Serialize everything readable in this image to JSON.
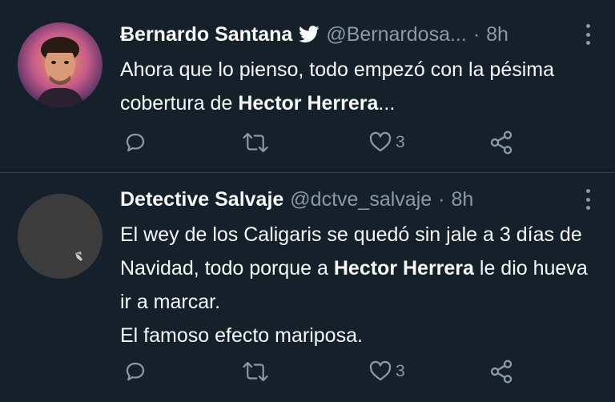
{
  "tweets": [
    {
      "author_name": "Ƀernardo Santana",
      "handle": "@Bernardosa...",
      "separator": "·",
      "time": "8h",
      "verified": true,
      "body_segments": [
        {
          "text": "Ahora que lo pienso, todo empezó con la pésima cobertura de ",
          "bold": false
        },
        {
          "text": "Hector Herrera",
          "bold": true
        },
        {
          "text": "...",
          "bold": false
        }
      ],
      "like_count": "3"
    },
    {
      "author_name": "Detective Salvaje",
      "handle": "@dctve_salvaje",
      "separator": "·",
      "time": "8h",
      "verified": false,
      "body_segments": [
        {
          "text": "El wey de los Caligaris se quedó sin jale a 3 días de Navidad, todo porque a ",
          "bold": false
        },
        {
          "text": "Hector Herrera",
          "bold": true
        },
        {
          "text": " le dio hueva ir a marcar.",
          "bold": false
        },
        {
          "text": "El famoso efecto mariposa.",
          "bold": false
        }
      ],
      "like_count": "3"
    }
  ],
  "icons": {
    "reply": "reply-icon",
    "retweet": "retweet-icon",
    "like": "heart-icon",
    "share": "share-icon",
    "more": "more-vertical-icon",
    "verified": "twitter-bird-icon"
  },
  "colors": {
    "background": "#15202b",
    "text": "#f7f9f9",
    "secondary": "#8b98a5",
    "divider": "#38444d"
  }
}
